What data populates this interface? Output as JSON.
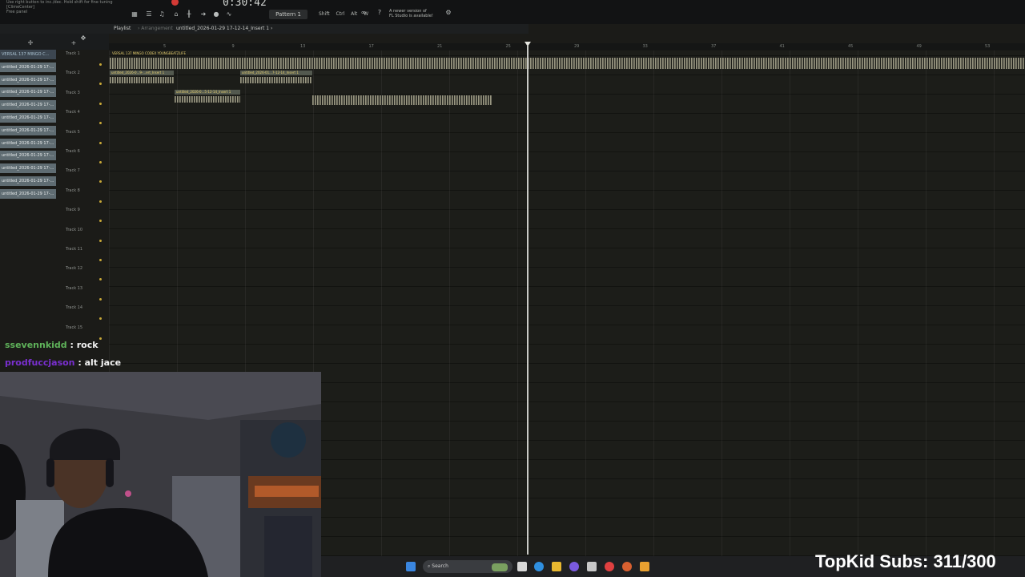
{
  "toolbar": {
    "hint_line1": "Use right button to inc./dec. Hold shift for fine tuning",
    "hint_line2": "[ClimeCenter]",
    "hint_line3": "Free panel",
    "time": "0:30:42",
    "pattern": "Pattern 1",
    "modkeys": "Shift Ctrl Alt W",
    "notice_line1": "A newer version of",
    "notice_line2": "FL Studio is available!"
  },
  "playlist": {
    "title": "Playlist",
    "arrangement": "› Arrangement",
    "file": "untitled_2026-01-29 17-12-14_Insert 1 ›",
    "bar_numbers": [
      "5",
      "9",
      "13",
      "17",
      "21",
      "25",
      "29",
      "33",
      "37",
      "41",
      "45",
      "49",
      "53"
    ]
  },
  "clip_list": [
    "VERSAL 137 MINGO C...",
    "untitled_2026-01-29 17-...",
    "untitled_2026-01-29 17-...",
    "untitled_2026-01-29 17-...",
    "untitled_2026-01-29 17-...",
    "untitled_2026-01-29 17-...",
    "untitled_2026-01-29 17-...",
    "untitled_2026-01-29 17-...",
    "untitled_2026-01-29 17-...",
    "untitled_2026-01-29 17-...",
    "untitled_2026-01-29 17-...",
    "untitled_2026-01-29 17-..."
  ],
  "tracks": [
    "Track 1",
    "Track 2",
    "Track 3",
    "Track 4",
    "Track 5",
    "Track 6",
    "Track 7",
    "Track 8",
    "Track 9",
    "Track 10",
    "Track 11",
    "Track 12",
    "Track 13",
    "Track 14",
    "Track 15"
  ],
  "clips": {
    "main": "VERSAL 137 MINGO CODEX YOUNGBEATZLIFE",
    "c1": "untitled_2026-0...9-...ert_Insert 1",
    "c2": "untitled_2026-01...7-12-14_Insert 1",
    "c3": "untitled_2026-0...5-12-14_Insert 1"
  },
  "chat": [
    {
      "user": "ssevennkidd",
      "sep": " : ",
      "message": "rock"
    },
    {
      "user": "prodfuccjason",
      "sep": " : ",
      "message": "alt jace"
    }
  ],
  "taskbar": {
    "search": "Search"
  },
  "overlay": {
    "subs": "TopKid Subs: 311/300"
  },
  "colors": {
    "chat_user1": "#5fb35a",
    "chat_user2": "#7a2fd0",
    "record": "#d33a35",
    "track_led": "#c8a838"
  }
}
